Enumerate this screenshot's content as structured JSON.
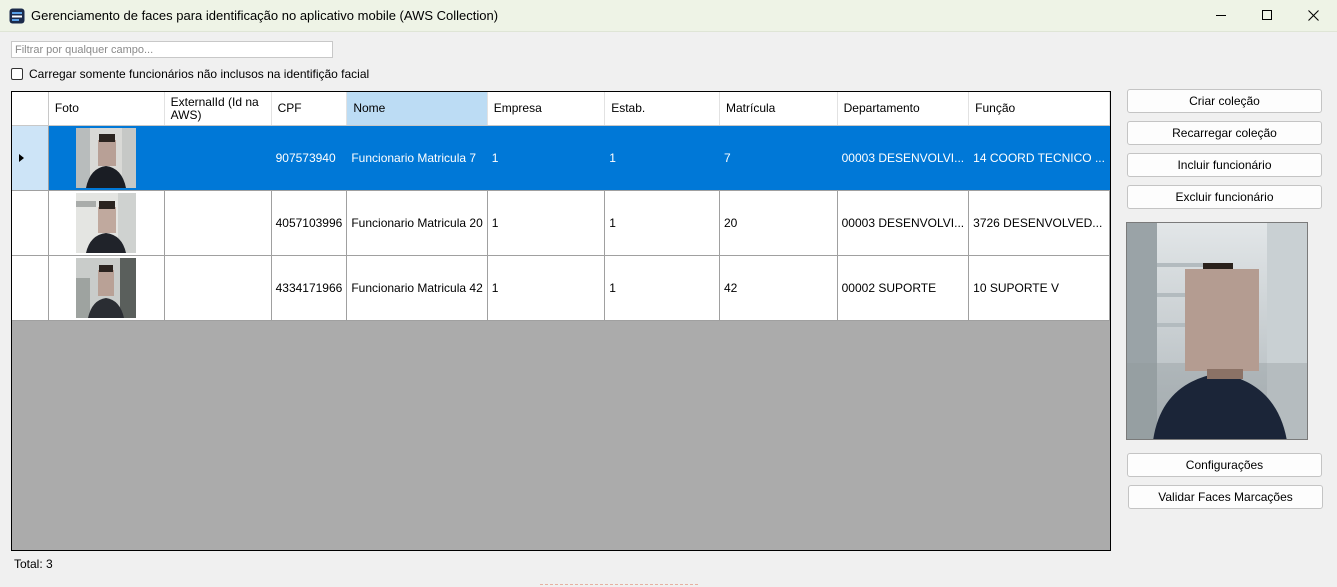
{
  "window": {
    "title": "Gerenciamento de faces para identificação no aplicativo mobile (AWS Collection)",
    "controls": [
      "minimize-icon",
      "maximize-icon",
      "close-icon"
    ]
  },
  "filter": {
    "placeholder": "Filtrar por qualquer campo..."
  },
  "checkbox": {
    "label": "Carregar somente funcionários não inclusos na identifição facial",
    "checked": false
  },
  "grid": {
    "columns": [
      "Foto",
      "ExternalId (Id na AWS)",
      "CPF",
      "Nome",
      "Empresa",
      "Estab.",
      "Matrícula",
      "Departamento",
      "Função"
    ],
    "sorted_column": "Nome",
    "rows": [
      {
        "selected": true,
        "externalId": "",
        "cpf": "907573940",
        "nome": "Funcionario Matricula 7",
        "empresa": "1",
        "estab": "1",
        "matricula": "7",
        "departamento": "00003 DESENVOLVI...",
        "funcao": "14 COORD TECNICO ..."
      },
      {
        "selected": false,
        "externalId": "",
        "cpf": "4057103996",
        "nome": "Funcionario Matricula 20",
        "empresa": "1",
        "estab": "1",
        "matricula": "20",
        "departamento": "00003 DESENVOLVI...",
        "funcao": "3726 DESENVOLVED..."
      },
      {
        "selected": false,
        "externalId": "",
        "cpf": "4334171966",
        "nome": "Funcionario Matricula 42",
        "empresa": "1",
        "estab": "1",
        "matricula": "42",
        "departamento": "00002 SUPORTE",
        "funcao": "10 SUPORTE V"
      }
    ]
  },
  "buttons": {
    "criar": "Criar coleção",
    "recarregar": "Recarregar coleção",
    "incluir": "Incluir funcionário",
    "excluir": "Excluir funcionário",
    "configuracoes": "Configurações",
    "validar": "Validar Faces Marcações"
  },
  "footer": {
    "total": "Total: 3"
  },
  "colors": {
    "selection": "#0078d7",
    "grid_background": "#ababab",
    "sorted_header": "#bcdcf4",
    "titlebar": "#eef3e6"
  }
}
